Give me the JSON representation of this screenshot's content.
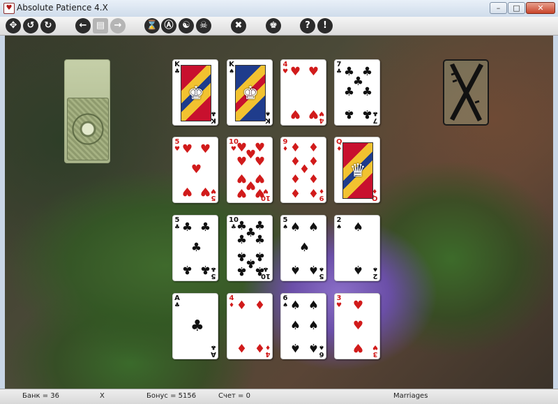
{
  "window": {
    "title": "Absolute Patience 4.X",
    "app_icon": "cards-icon",
    "controls": [
      "minimize",
      "maximize",
      "close"
    ]
  },
  "toolbar": {
    "buttons": [
      {
        "name": "new-game-button",
        "icon": "four-arrows-icon"
      },
      {
        "name": "undo-button",
        "icon": "undo-arrow-icon"
      },
      {
        "name": "redo-button",
        "icon": "redo-arrow-icon"
      },
      {
        "name": "back-button",
        "icon": "left-arrow-icon"
      },
      {
        "name": "clapper-button",
        "icon": "clapperboard-icon",
        "disabled": true
      },
      {
        "name": "forward-button",
        "icon": "right-arrow-icon",
        "disabled": true
      },
      {
        "name": "timer-button",
        "icon": "hourglass-icon"
      },
      {
        "name": "auto-button",
        "icon": "letter-a-icon"
      },
      {
        "name": "yin-yang-button",
        "icon": "yin-yang-icon"
      },
      {
        "name": "skull-button",
        "icon": "skull-icon"
      },
      {
        "name": "tools-button",
        "icon": "tools-icon"
      },
      {
        "name": "trophy-button",
        "icon": "trophy-icon"
      },
      {
        "name": "help-button",
        "icon": "question-icon"
      },
      {
        "name": "info-button",
        "icon": "exclamation-icon"
      }
    ]
  },
  "tableau": {
    "rows": [
      [
        {
          "rank": "K",
          "suit": "♣",
          "color": "black",
          "face": true
        },
        {
          "rank": "K",
          "suit": "♠",
          "color": "black",
          "face": true
        },
        {
          "rank": "4",
          "suit": "♥",
          "color": "red"
        },
        {
          "rank": "7",
          "suit": "♣",
          "color": "black"
        }
      ],
      [
        {
          "rank": "5",
          "suit": "♥",
          "color": "red"
        },
        {
          "rank": "10",
          "suit": "♥",
          "color": "red"
        },
        {
          "rank": "9",
          "suit": "♦",
          "color": "red"
        },
        {
          "rank": "Q",
          "suit": "♦",
          "color": "red",
          "face": true
        }
      ],
      [
        {
          "rank": "5",
          "suit": "♣",
          "color": "black"
        },
        {
          "rank": "10",
          "suit": "♣",
          "color": "black"
        },
        {
          "rank": "5",
          "suit": "♠",
          "color": "black"
        },
        {
          "rank": "2",
          "suit": "♠",
          "color": "black"
        }
      ],
      [
        {
          "rank": "A",
          "suit": "♣",
          "color": "black"
        },
        {
          "rank": "4",
          "suit": "♦",
          "color": "red"
        },
        {
          "rank": "6",
          "suit": "♠",
          "color": "black"
        },
        {
          "rank": "3",
          "suit": "♥",
          "color": "red"
        }
      ]
    ]
  },
  "stock": {
    "icon": "card-back-icon"
  },
  "discard": {
    "icon": "x-mark-icon"
  },
  "status": {
    "bank": "Банк = 36",
    "mode": "X",
    "bonus": "Бонус = 5156",
    "score": "Счет = 0",
    "game": "Marriages"
  },
  "colors": {
    "red_suit": "#d11b1b",
    "black_suit": "#111111",
    "titlebar": "#cfdceb"
  }
}
